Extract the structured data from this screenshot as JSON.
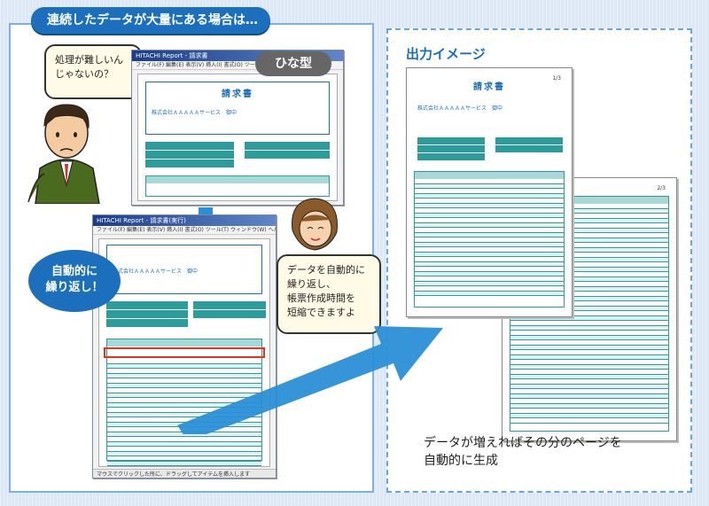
{
  "header": {
    "title": "連続したデータが大量にある場合は…"
  },
  "man": {
    "bubble_text": "処理が難しいん\nじゃないの？"
  },
  "woman": {
    "bubble_text": "データを自動的に\n繰り返し、\n帳票作成時間を\n短縮できますよ"
  },
  "labels": {
    "hinagata": "ひな型",
    "auto_repeat": "自動的に\n繰り返し！",
    "output_image": "出力イメージ",
    "caption": "データが増えればその分のページを\n自動的に生成"
  },
  "invoice": {
    "title": "請求書",
    "company": "株式会社ＡＡＡＡＡサービス　御中",
    "page_num_1": "1/3",
    "page_num_2": "2/3"
  },
  "windows": {
    "template_title": "HITACHI Report - 請求書",
    "result_title": "HITACHI Report - 請求書(実行)",
    "menu": "ファイル(F)  編集(E)  表示(V)  挿入(I)  書式(O)  ツール(T)  ウィンドウ(W)  ヘルプ(H)",
    "status": "マウスでクリックした所に、ドラッグしてアイテムを挿入します"
  },
  "colors": {
    "accent": "#1b6fbd",
    "teal": "#2c9c9c",
    "highlight": "#e8321e"
  }
}
